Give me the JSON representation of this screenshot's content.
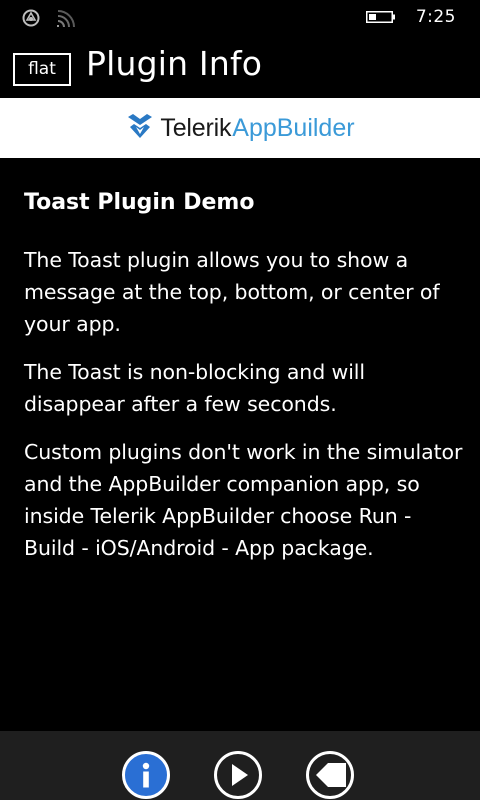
{
  "status_bar": {
    "time": "7:25"
  },
  "header": {
    "flat_label": "flat",
    "title": "Plugin Info"
  },
  "brand": {
    "telerik": "Telerik",
    "appbuilder": "AppBuilder",
    "accent_color": "#3b9ad8"
  },
  "content": {
    "heading": "Toast Plugin Demo",
    "paragraphs": [
      "The Toast plugin allows you to show a message at the top, bottom, or center of your app.",
      "The Toast is non-blocking and will disappear after a few seconds.",
      "Custom plugins don't work in the simulator and the AppBuilder companion app, so inside Telerik AppBuilder choose Run - Build - iOS/Android - App package."
    ]
  },
  "app_bar": {
    "buttons": [
      {
        "icon": "info-icon",
        "active": true
      },
      {
        "icon": "play-icon",
        "active": false
      },
      {
        "icon": "back-icon",
        "active": false
      }
    ],
    "active_color": "#2a6fd4"
  }
}
